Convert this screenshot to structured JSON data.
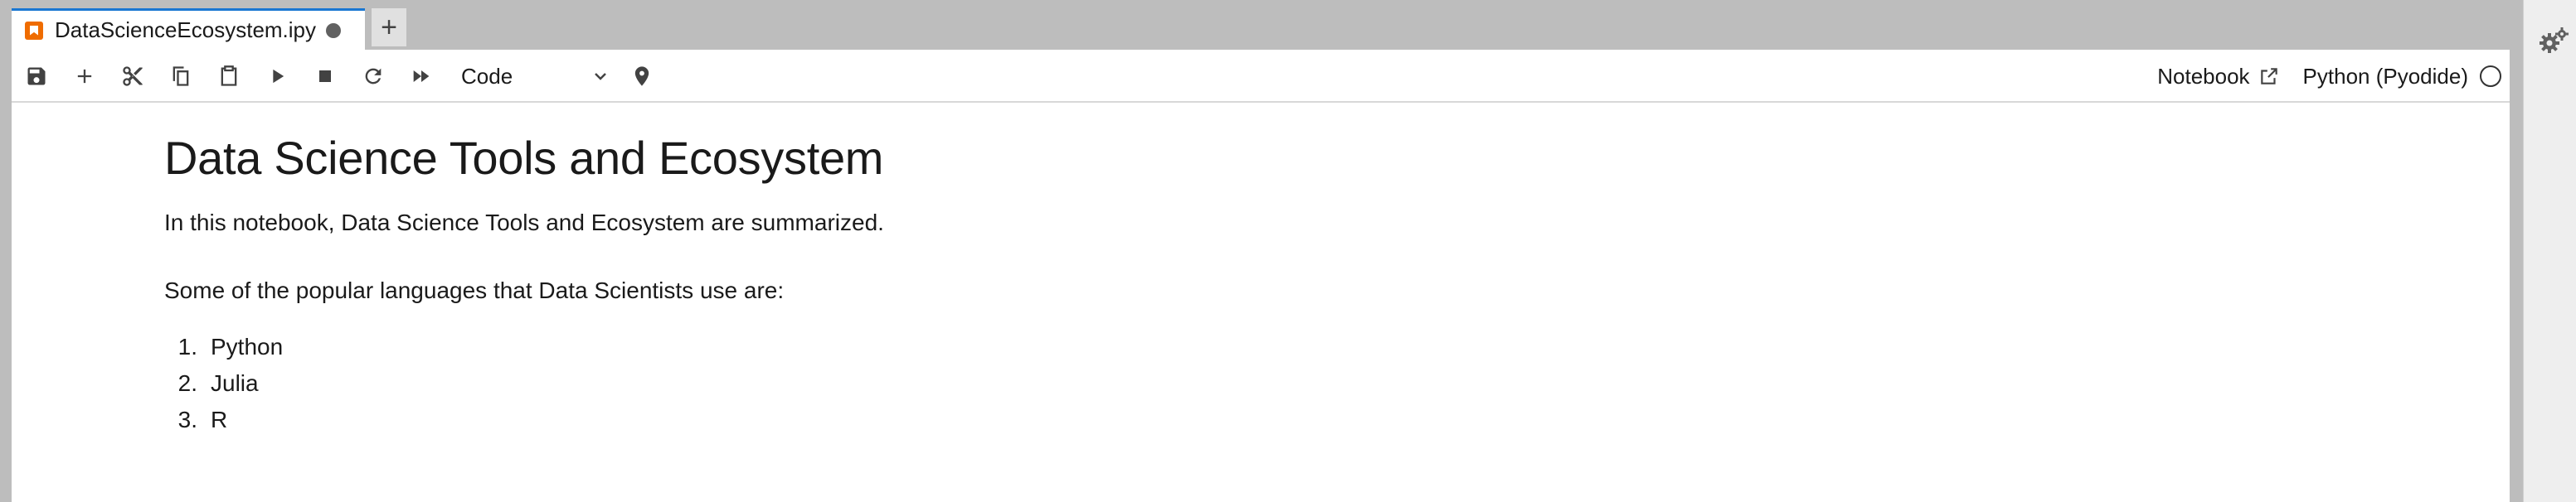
{
  "tab": {
    "title": "DataScienceEcosystem.ipy",
    "icon": "notebook-icon",
    "new_tab_label": "+"
  },
  "toolbar": {
    "cell_type": "Code",
    "notebook_label": "Notebook",
    "kernel_name": "Python (Pyodide)",
    "accent_color": "#1976d2"
  },
  "notebook": {
    "heading": "Data Science Tools and Ecosystem",
    "intro": "In this notebook, Data Science Tools and Ecosystem are summarized.",
    "languages_intro": "Some of the popular languages that Data Scientists use are:",
    "languages": [
      {
        "num": "1.",
        "name": "Python"
      },
      {
        "num": "2.",
        "name": "Julia"
      },
      {
        "num": "3.",
        "name": "R"
      }
    ]
  }
}
